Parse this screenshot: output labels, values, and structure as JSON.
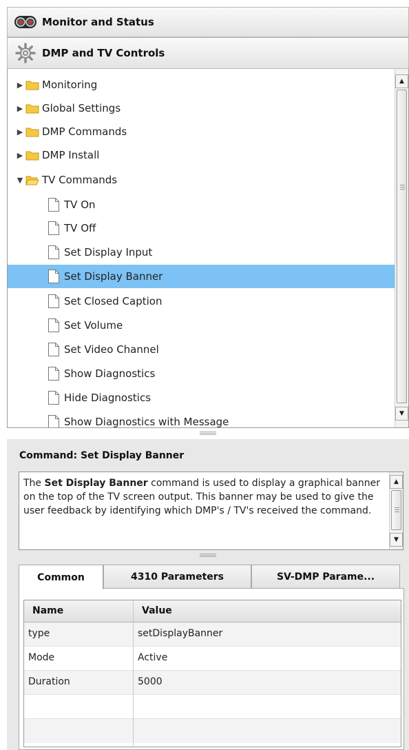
{
  "accordion": {
    "monitor_label": "Monitor and Status",
    "dmp_label": "DMP and TV Controls"
  },
  "tree": {
    "folders": [
      {
        "label": "Monitoring",
        "expanded": false
      },
      {
        "label": "Global Settings",
        "expanded": false
      },
      {
        "label": "DMP Commands",
        "expanded": false
      },
      {
        "label": "DMP Install",
        "expanded": false
      },
      {
        "label": "TV Commands",
        "expanded": true
      }
    ],
    "commands": [
      {
        "label": "TV On"
      },
      {
        "label": "TV Off"
      },
      {
        "label": "Set Display Input"
      },
      {
        "label": "Set Display Banner"
      },
      {
        "label": "Set Closed Caption"
      },
      {
        "label": "Set Volume"
      },
      {
        "label": "Set Video Channel"
      },
      {
        "label": "Show Diagnostics"
      },
      {
        "label": "Hide Diagnostics"
      },
      {
        "label": "Show Diagnostics with Message"
      }
    ],
    "selected": "Set Display Banner"
  },
  "command": {
    "title": "Command: Set Display Banner",
    "desc_prefix": "The ",
    "desc_bold": "Set Display Banner",
    "desc_rest": " command is used to display a graphical banner on the top of the TV screen output. This banner may be used to give the user feedback by identifying which DMP's / TV's received the command."
  },
  "tabs": [
    "Common",
    "4310 Parameters",
    "SV-DMP Parame..."
  ],
  "grid": {
    "headers": [
      "Name",
      "Value"
    ],
    "rows": [
      [
        "type",
        "setDisplayBanner"
      ],
      [
        "Mode",
        "Active"
      ],
      [
        "Duration",
        "5000"
      ],
      [
        "",
        ""
      ],
      [
        "",
        ""
      ]
    ]
  },
  "colors": {
    "selection": "#7cc2f5",
    "folder": "#f5c842"
  },
  "icons": {
    "monitor": "monitor-status-icon",
    "dmp": "gear-icon",
    "folder": "folder-icon",
    "document": "document-icon"
  }
}
